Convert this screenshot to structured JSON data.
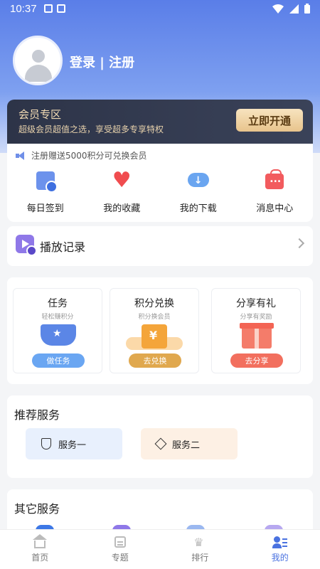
{
  "status_bar": {
    "time": "10:37"
  },
  "profile": {
    "login_label": "登录 | 注册"
  },
  "vip": {
    "title": "会员专区",
    "subtitle": "超级会员超值之选，享受超多专享特权",
    "button": "立即开通",
    "colors": {
      "bg": "#2d3448",
      "gold": "#e8c48c"
    }
  },
  "notice": {
    "text": "注册赠送5000积分可兑换会员"
  },
  "quick_actions": [
    {
      "label": "每日签到",
      "icon": "calendar-check-icon"
    },
    {
      "label": "我的收藏",
      "icon": "heart-icon"
    },
    {
      "label": "我的下载",
      "icon": "cloud-download-icon"
    },
    {
      "label": "消息中心",
      "icon": "message-bag-icon"
    }
  ],
  "history": {
    "label": "播放记录",
    "icon": "play-history-icon"
  },
  "tasks": [
    {
      "title": "任务",
      "subtitle": "轻松赚积分",
      "button": "做任务",
      "color": "#6aa6f2",
      "icon": "trophy-icon"
    },
    {
      "title": "积分兑换",
      "subtitle": "积分换会员",
      "button": "去兑换",
      "color": "#e0a84e",
      "icon": "coin-icon"
    },
    {
      "title": "分享有礼",
      "subtitle": "分享有奖励",
      "button": "去分享",
      "color": "#f26f5e",
      "icon": "gift-icon"
    }
  ],
  "recommended": {
    "title": "推荐服务",
    "items": [
      {
        "label": "服务一",
        "icon": "shield-icon",
        "bg": "#e8f0fd"
      },
      {
        "label": "服务二",
        "icon": "diamond-icon",
        "bg": "#fdf0e4"
      }
    ]
  },
  "other": {
    "title": "其它服务"
  },
  "tabbar": [
    {
      "label": "首页",
      "icon": "home-icon",
      "active": false
    },
    {
      "label": "专题",
      "icon": "topic-icon",
      "active": false
    },
    {
      "label": "排行",
      "icon": "crown-icon",
      "active": false
    },
    {
      "label": "我的",
      "icon": "profile-icon",
      "active": true
    }
  ],
  "accent_color": "#4a72e0"
}
